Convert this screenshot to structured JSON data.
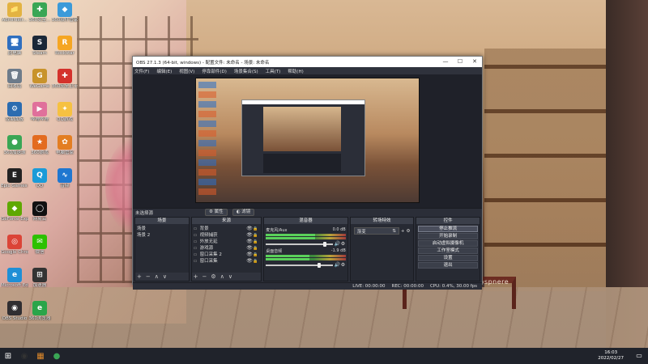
{
  "desktop": {
    "icons": [
      {
        "label": "Administr...",
        "glyph": "📁",
        "color": "#e3b341"
      },
      {
        "label": "此电脑",
        "glyph": "🖥",
        "color": "#2f6fbf"
      },
      {
        "label": "回收站",
        "glyph": "🗑",
        "color": "#6d7b8a"
      },
      {
        "label": "控制面板",
        "glyph": "⚙",
        "color": "#2b6cb0"
      },
      {
        "label": "360加速球",
        "glyph": "●",
        "color": "#3aa655"
      },
      {
        "label": "Epic Games Launcher",
        "glyph": "E",
        "color": "#222"
      },
      {
        "label": "GeForce Experience",
        "glyph": "◆",
        "color": "#5fa800"
      },
      {
        "label": "Google Chrome",
        "glyph": "◎",
        "color": "#db4437"
      },
      {
        "label": "Microsoft Edge",
        "glyph": "e",
        "color": "#1f8fd6"
      },
      {
        "label": "OBS Studio",
        "glyph": "◉",
        "color": "#302e31"
      },
      {
        "label": "360安全...",
        "glyph": "✚",
        "color": "#3aa655"
      },
      {
        "label": "Steam",
        "glyph": "S",
        "color": "#1b2838"
      },
      {
        "label": "WeGame",
        "glyph": "G",
        "color": "#c8932b"
      },
      {
        "label": "哔哩哔哩",
        "glyph": "▶",
        "color": "#e0709b"
      },
      {
        "label": "360游戏",
        "glyph": "★",
        "color": "#e36b1f"
      },
      {
        "label": "QQ",
        "glyph": "Q",
        "color": "#1a9bd8"
      },
      {
        "label": "网易云",
        "glyph": "◯",
        "color": "#111"
      },
      {
        "label": "微信",
        "glyph": "✉",
        "color": "#2dc100"
      },
      {
        "label": "加速器",
        "glyph": "⊞",
        "color": "#333"
      },
      {
        "label": "360浏览器",
        "glyph": "e",
        "color": "#2aa54a"
      },
      {
        "label": "360软件管家",
        "glyph": "◆",
        "color": "#3b9ad9"
      },
      {
        "label": "Rockstar",
        "glyph": "R",
        "color": "#f5a623"
      },
      {
        "label": "360安全卫士",
        "glyph": "✚",
        "color": "#d4322c"
      },
      {
        "label": "QQ游戏",
        "glyph": "✦",
        "color": "#f6c141"
      },
      {
        "label": "电脑管家",
        "glyph": "✿",
        "color": "#e37e22"
      },
      {
        "label": "音频",
        "glyph": "∿",
        "color": "#1f77d0"
      }
    ]
  },
  "scene_overlay_text": "Ashion Tea Gospnere",
  "obs": {
    "title": "OBS 27.1.3 (64-bit, windows) - 配置文件: 未命名 - 场景: 未命名",
    "window_controls": [
      "—",
      "☐",
      "✕"
    ],
    "menu": [
      "文件(F)",
      "编辑(E)",
      "视图(V)",
      "停靠部件(D)",
      "场景集合(S)",
      "工具(T)",
      "帮助(H)"
    ],
    "label_bar": {
      "title": "未选择源",
      "properties": "⚙ 属性",
      "filters": "◐ 滤镜"
    },
    "docks": {
      "scenes": {
        "title": "场景",
        "items": [
          "场景",
          "场景 2"
        ],
        "footer": [
          "+",
          "−",
          "∧",
          "∨"
        ]
      },
      "sources": {
        "title": "来源",
        "items": [
          {
            "name": "背景",
            "icon": "▭"
          },
          {
            "name": "视频捕获",
            "icon": "▭"
          },
          {
            "name": "外放无延",
            "icon": "▭"
          },
          {
            "name": "游戏源",
            "icon": "▭"
          },
          {
            "name": "窗口采集 2",
            "icon": "▭"
          },
          {
            "name": "窗口采集",
            "icon": "▭"
          }
        ],
        "eye": "👁",
        "lock": "🔒",
        "footer": [
          "+",
          "−",
          "⚙",
          "∧",
          "∨"
        ]
      },
      "mixer": {
        "title": "混音器",
        "tracks": [
          {
            "name": "麦克风/Aux",
            "db": "0.0 dB",
            "level": 0.62,
            "volume": 0.88
          },
          {
            "name": "桌面音频",
            "db": "-1.9 dB",
            "level": 0.55,
            "volume": 0.8
          }
        ],
        "speaker": "🔊",
        "gear": "⚙"
      },
      "transitions": {
        "title": "转场特效",
        "selected": "渐变",
        "arrow": "⇅",
        "plus": "+",
        "gear": "⚙"
      },
      "controls": {
        "title": "控件",
        "buttons": [
          "停止推流",
          "开始录制",
          "启动虚拟摄像机",
          "工作室模式",
          "设置",
          "退出"
        ]
      }
    },
    "status": {
      "live": "LIVE: 00:00:00",
      "rec": "REC: 00:00:00",
      "cpu": "CPU: 0.4%, 30.00 fps"
    }
  },
  "taskbar": {
    "start": "⊞",
    "apps": [
      {
        "glyph": "◉",
        "color": "#333"
      },
      {
        "glyph": "▦",
        "color": "#e08a2b"
      },
      {
        "glyph": "●",
        "color": "#3aa655"
      }
    ],
    "time": "16:03",
    "date": "2022/02/27",
    "notification": "▭"
  }
}
